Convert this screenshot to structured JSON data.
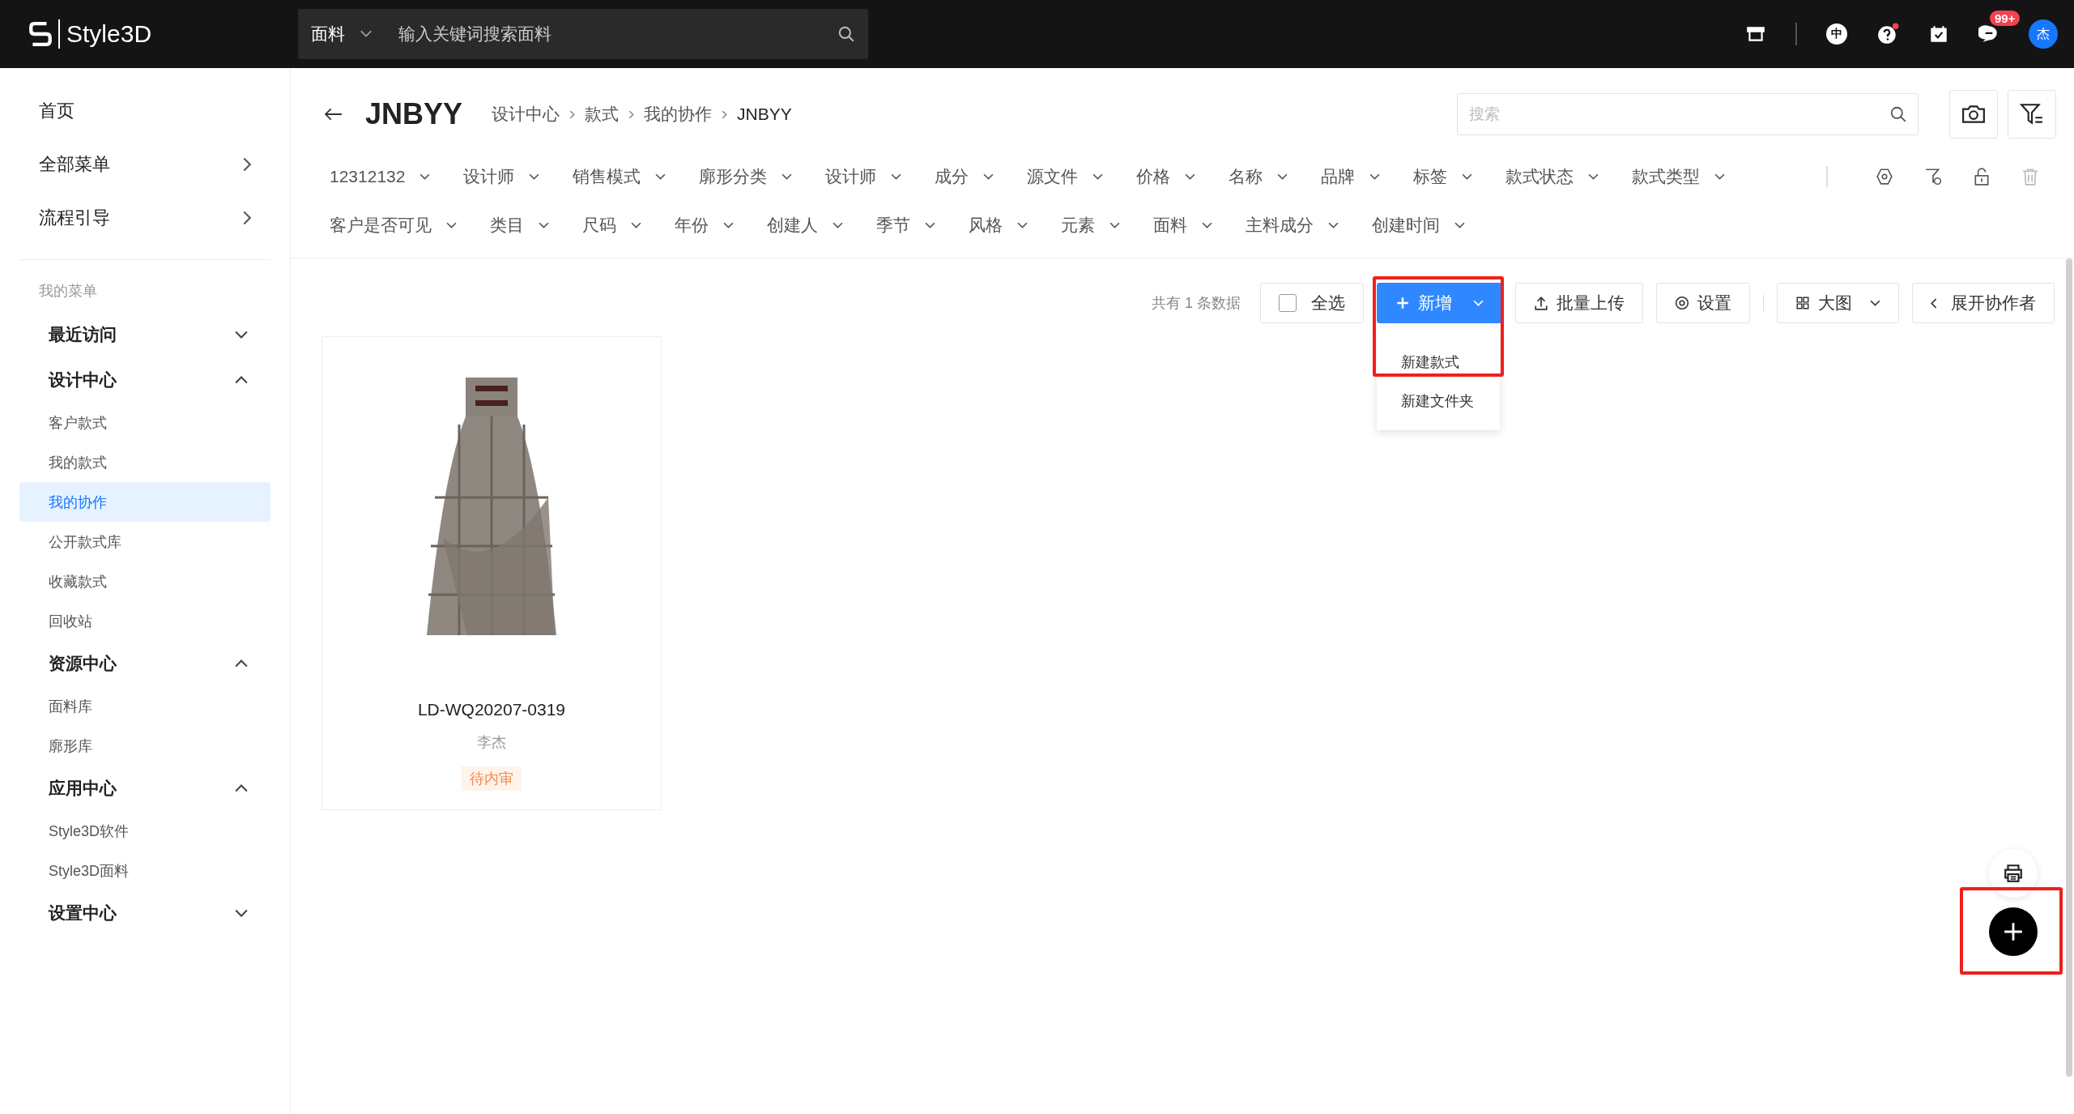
{
  "topbar": {
    "logo_text": "Style3D",
    "search": {
      "category": "面料",
      "placeholder": "输入关键词搜索面料"
    },
    "lang_badge": "中",
    "message_badge": "99+",
    "avatar": "杰"
  },
  "sidebar": {
    "top_items": [
      {
        "label": "首页",
        "kind": "link"
      },
      {
        "label": "全部菜单",
        "kind": "submenu"
      },
      {
        "label": "流程引导",
        "kind": "submenu"
      }
    ],
    "section_label": "我的菜单",
    "groups": [
      {
        "label": "最近访问",
        "expanded": false
      },
      {
        "label": "设计中心",
        "expanded": true,
        "children": [
          {
            "label": "客户款式",
            "selected": false
          },
          {
            "label": "我的款式",
            "selected": false
          },
          {
            "label": "我的协作",
            "selected": true
          },
          {
            "label": "公开款式库",
            "selected": false
          },
          {
            "label": "收藏款式",
            "selected": false
          },
          {
            "label": "回收站",
            "selected": false
          }
        ]
      },
      {
        "label": "资源中心",
        "expanded": true,
        "children": [
          {
            "label": "面料库",
            "selected": false
          },
          {
            "label": "廓形库",
            "selected": false
          }
        ]
      },
      {
        "label": "应用中心",
        "expanded": true,
        "children": [
          {
            "label": "Style3D软件",
            "selected": false
          },
          {
            "label": "Style3D面料",
            "selected": false
          }
        ]
      },
      {
        "label": "设置中心",
        "expanded": false
      }
    ]
  },
  "header": {
    "title": "JNBYY",
    "breadcrumb": [
      "设计中心",
      "款式",
      "我的协作",
      "JNBYY"
    ],
    "search": {
      "placeholder": "搜索"
    }
  },
  "filters": {
    "lines": [
      {
        "items": [
          "12312132",
          "设计师",
          "销售模式",
          "廓形分类",
          "设计师",
          "成分",
          "源文件",
          "价格",
          "名称",
          "品牌",
          "标签",
          "款式状态",
          "款式类型"
        ]
      },
      {
        "items": [
          "客户是否可见",
          "类目",
          "尺码",
          "年份",
          "创建人",
          "季节",
          "风格",
          "元素",
          "面料",
          "主料成分",
          "创建时间"
        ]
      }
    ]
  },
  "toolbar": {
    "count": "共有 1 条数据",
    "select_all": {
      "label": "全选",
      "checked": false
    },
    "new_button": {
      "label": "新增",
      "expanded": true,
      "menu": [
        "新建款式",
        "新建文件夹"
      ]
    },
    "batch_upload": "批量上传",
    "settings": "设置",
    "view": "大图",
    "expand": "展开协作者"
  },
  "cards": [
    {
      "code": "LD-WQ20207-0319",
      "author": "李杰",
      "status": "待内审"
    }
  ]
}
